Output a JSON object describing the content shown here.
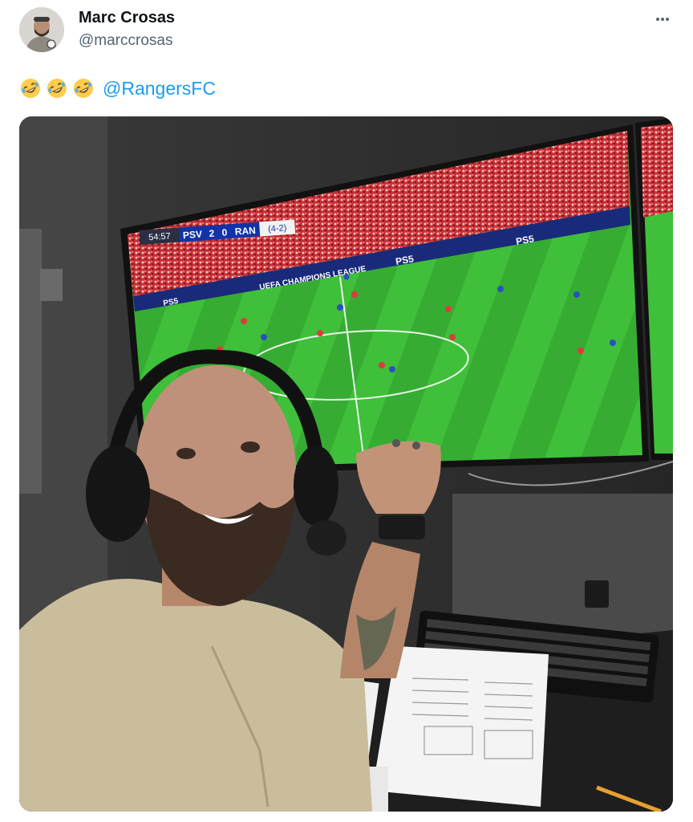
{
  "author": {
    "name": "Marc Crosas",
    "handle": "@marccrosas"
  },
  "tweet": {
    "emojis": [
      "rolling-on-floor-laughing",
      "rolling-on-floor-laughing",
      "rolling-on-floor-laughing"
    ],
    "mention": "@RangersFC"
  },
  "scoreboard": {
    "clock": "54:57",
    "home": "PSV",
    "home_score": "2",
    "away_score": "0",
    "away": "RAN",
    "aggregate": "(4-2)"
  },
  "stadium": {
    "ad_board": "PS5",
    "competition_board": "UEFA CHAMPIONS LEAGUE"
  },
  "colors": {
    "link": "#1d9bf0",
    "secondary_text": "#536471",
    "pitch": "#3fbf3a",
    "crowd": "#c8313a"
  }
}
